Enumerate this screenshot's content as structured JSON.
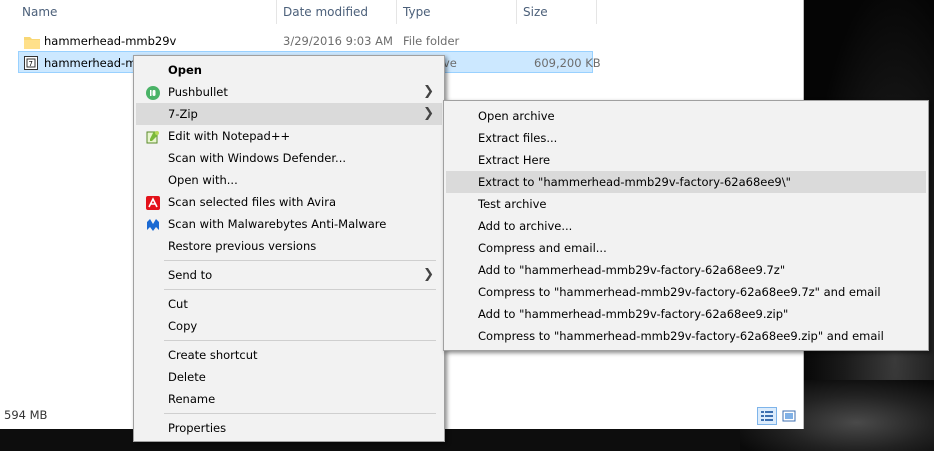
{
  "columns": {
    "name": "Name",
    "date": "Date modified",
    "type": "Type",
    "size": "Size"
  },
  "files": [
    {
      "name": "hammerhead-mmb29v",
      "date": "3/29/2016 9:03 AM",
      "type": "File folder",
      "size": ""
    },
    {
      "name": "hammerhead-mm",
      "date": "",
      "type": "ve",
      "size": "609,200 KB"
    }
  ],
  "status": {
    "size_text": "594 MB"
  },
  "context_menu": {
    "items": [
      {
        "label": "Open",
        "icon": ""
      },
      {
        "label": "Pushbullet",
        "icon": "pushbullet-icon"
      },
      {
        "label": "7-Zip",
        "icon": ""
      },
      {
        "label": "Edit with Notepad++",
        "icon": "notepad-plus-plus-icon"
      },
      {
        "label": "Scan with Windows Defender...",
        "icon": ""
      },
      {
        "label": "Open with...",
        "icon": ""
      },
      {
        "label": "Scan selected files with Avira",
        "icon": "avira-icon"
      },
      {
        "label": "Scan with Malwarebytes Anti-Malware",
        "icon": "malwarebytes-icon"
      },
      {
        "label": "Restore previous versions",
        "icon": ""
      },
      {
        "label": "Send to",
        "icon": ""
      },
      {
        "label": "Cut",
        "icon": ""
      },
      {
        "label": "Copy",
        "icon": ""
      },
      {
        "label": "Create shortcut",
        "icon": ""
      },
      {
        "label": "Delete",
        "icon": ""
      },
      {
        "label": "Rename",
        "icon": ""
      },
      {
        "label": "Properties",
        "icon": ""
      }
    ]
  },
  "zip_submenu": {
    "items": [
      "Open archive",
      "Extract files...",
      "Extract Here",
      "Extract to \"hammerhead-mmb29v-factory-62a68ee9\\\"",
      "Test archive",
      "Add to archive...",
      "Compress and email...",
      "Add to \"hammerhead-mmb29v-factory-62a68ee9.7z\"",
      "Compress to \"hammerhead-mmb29v-factory-62a68ee9.7z\" and email",
      "Add to \"hammerhead-mmb29v-factory-62a68ee9.zip\"",
      "Compress to \"hammerhead-mmb29v-factory-62a68ee9.zip\" and email"
    ]
  },
  "colors": {
    "selection": "#cce8ff",
    "menu_bg": "#f2f2f2",
    "menu_hover": "#dadada",
    "header_text": "#4c607a"
  }
}
